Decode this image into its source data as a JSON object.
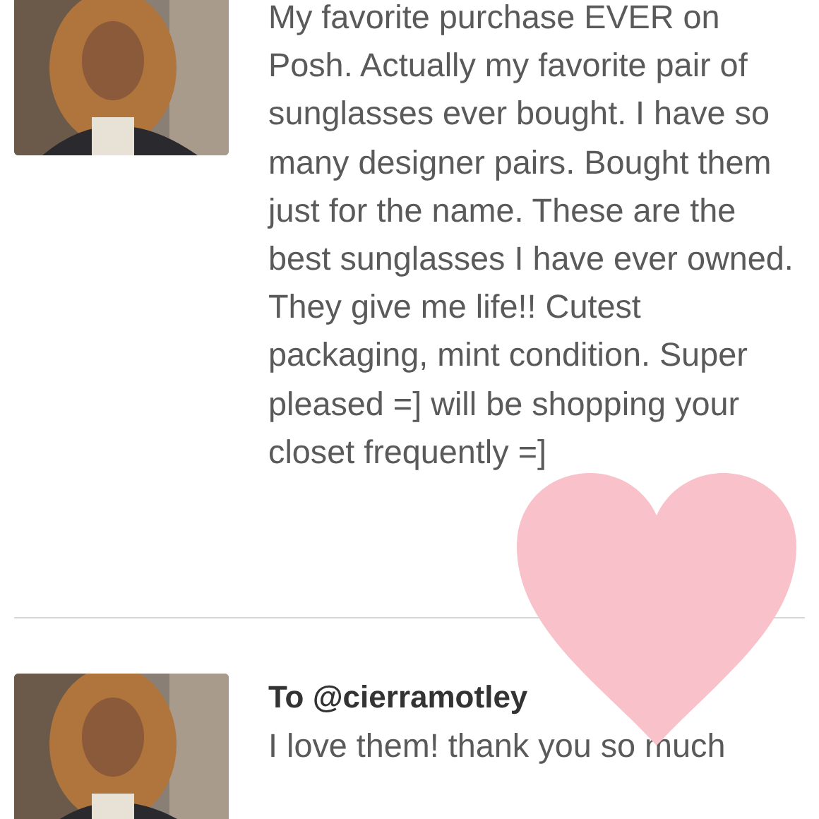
{
  "comments": [
    {
      "message": "My favorite purchase EVER on Posh. Actually my favorite pair of sunglasses ever bought. I have so many designer pairs. Bought them just for the name. These are the best sunglasses I have ever owned. They give me life!! Cutest packaging, mint condition. Super pleased =] will be shopping your closet frequently =]"
    },
    {
      "to": "To @cierramotley",
      "message": "I love them! thank you so much"
    }
  ],
  "overlay": {
    "kind": "heart"
  }
}
